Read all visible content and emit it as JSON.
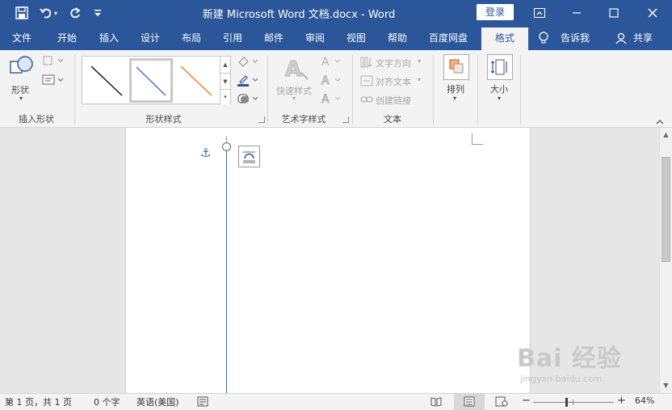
{
  "titlebar": {
    "title": "新建 Microsoft Word 文档.docx  -  Word",
    "login": "登录",
    "qat": {
      "save": "save-icon",
      "undo": "undo-icon",
      "redo": "redo-icon",
      "customize": "customize-icon"
    },
    "controls": {
      "ribbon_display": "ribbon-display-icon",
      "minimize": "minimize-icon",
      "restore": "restore-icon",
      "close": "close-icon"
    }
  },
  "tabs": [
    "文件",
    "开始",
    "插入",
    "设计",
    "布局",
    "引用",
    "邮件",
    "审阅",
    "视图",
    "帮助",
    "百度网盘",
    "格式"
  ],
  "active_tab": "格式",
  "tell_me": "告诉我",
  "share": "共享",
  "ribbon": {
    "insert_shapes": {
      "shapes_label": "形状",
      "group_label": "插入形状"
    },
    "shape_styles": {
      "group_label": "形状样式",
      "swatch_colors": [
        "#1a1a1a",
        "#4472c4",
        "#ed7d31"
      ]
    },
    "wordart_styles": {
      "quick_styles_label": "快速样式",
      "group_label": "艺术字样式"
    },
    "text": {
      "text_direction": "文字方向",
      "align_text": "对齐文本",
      "create_link": "创建链接",
      "group_label": "文本"
    },
    "arrange": {
      "label": "排列"
    },
    "size": {
      "label": "大小"
    }
  },
  "status": {
    "page": "第 1 页，共 1 页",
    "words": "0 个字",
    "language": "英语(美国)",
    "zoom": "64%",
    "zoom_minus": "−",
    "zoom_plus": "+",
    "zoom_fraction": 0.4
  },
  "watermark": {
    "text": "Bai 经验",
    "url": "jingyan.baidu.com"
  },
  "colors": {
    "brand": "#2b579a",
    "ribbon_bg": "#f3f3f3",
    "line": "#3b6ea5"
  }
}
